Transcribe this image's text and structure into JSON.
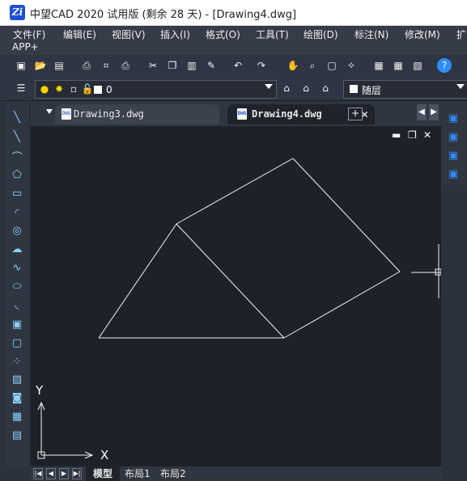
{
  "app": {
    "title": "中望CAD 2020 试用版 (剩余 28 天) - [Drawing4.dwg]",
    "logo_text": "Zi"
  },
  "menu": {
    "items": [
      "文件(F)",
      "编辑(E)",
      "视图(V)",
      "插入(I)",
      "格式(O)",
      "工具(T)",
      "绘图(D)",
      "标注(N)",
      "修改(M)",
      "扩"
    ],
    "app_label": "APP+"
  },
  "toolbar": {
    "icons": [
      "new-icon",
      "open-icon",
      "save-icon",
      "print-icon",
      "preview-icon",
      "plot-icon",
      "cut-icon",
      "copy-icon",
      "paste-icon",
      "match-properties-icon",
      "undo-icon",
      "redo-icon",
      "pan-icon",
      "zoom-realtime-icon",
      "zoom-window-icon",
      "zoom-previous-icon",
      "properties-icon",
      "design-center-icon",
      "tool-palette-icon",
      "help-icon"
    ]
  },
  "layer": {
    "value": "0",
    "color_value": "随层"
  },
  "tabs": {
    "inactive_label": "Drawing3.dwg",
    "active_label": "Drawing4.dwg",
    "dwg_mark": "DWG"
  },
  "tools": {
    "left": [
      "line-icon",
      "xline-icon",
      "polyline-icon",
      "polygon-icon",
      "rectangle-icon",
      "arc-icon",
      "circle-icon",
      "revcloud-icon",
      "spline-icon",
      "ellipse-icon",
      "ellipse-arc-icon",
      "insert-block-icon",
      "make-block-icon",
      "point-icon",
      "hatch-icon",
      "region-icon",
      "table-icon",
      "mtext-icon"
    ],
    "right": [
      "draw-order-front-icon",
      "draw-order-back-icon",
      "draw-order-above-icon",
      "draw-order-below-icon"
    ]
  },
  "canvas": {
    "ucs_x": "X",
    "ucs_y": "Y",
    "minimize": "▬",
    "restore": "❐",
    "close": "✕"
  },
  "layouts": {
    "model": "模型",
    "layout1": "布局1",
    "layout2": "布局2"
  },
  "colors": {
    "accent": "#2f8cff",
    "canvas": "#1e2128",
    "ui": "#303641"
  }
}
